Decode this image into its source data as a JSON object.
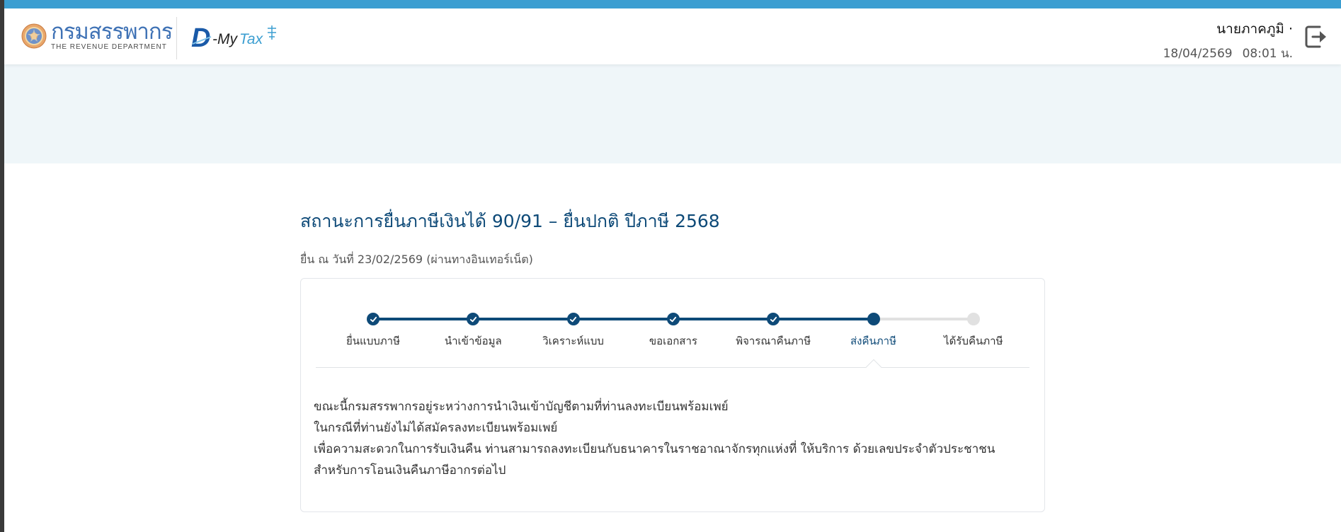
{
  "header": {
    "rd_name": "กรมสรรพากร",
    "rd_sub": "THE REVENUE DEPARTMENT",
    "dmytax_d": "D",
    "dmytax_my": "-My",
    "dmytax_tax": "Tax",
    "user_name": "นายภาคภูมิ ·",
    "date": "18/04/2569",
    "time": "08:01 น.",
    "logout_icon": "logout-icon"
  },
  "page": {
    "title": "สถานะการยื่นภาษีเงินได้ 90/91 – ยื่นปกติ ปีภาษี 2568",
    "subtitle": "ยื่น ณ วันที่ 23/02/2569 (ผ่านทางอินเทอร์เน็ต)"
  },
  "steps": [
    {
      "label": "ยื่นแบบภาษี",
      "status": "done"
    },
    {
      "label": "นำเข้าข้อมูล",
      "status": "done"
    },
    {
      "label": "วิเคราะห์แบบ",
      "status": "done"
    },
    {
      "label": "ขอเอกสาร",
      "status": "done"
    },
    {
      "label": "พิจารณาคืนภาษี",
      "status": "done"
    },
    {
      "label": "ส่งคืนภาษี",
      "status": "current"
    },
    {
      "label": "ได้รับคืนภาษี",
      "status": "pending"
    }
  ],
  "message": {
    "line1": "ขณะนี้กรมสรรพากรอยู่ระหว่างการนำเงินเข้าบัญชีตามที่ท่านลงทะเบียนพร้อมเพย์",
    "line2": "ในกรณีที่ท่านยังไม่ได้สมัครลงทะเบียนพร้อมเพย์",
    "line3": "เพื่อความสะดวกในการรับเงินคืน ท่านสามารถลงทะเบียนกับธนาคารในราชอาณาจักรทุกแห่งที่ ให้บริการ ด้วยเลขประจำตัวประชาชน",
    "line4": "สำหรับการโอนเงินคืนภาษีอากรต่อไป"
  },
  "colors": {
    "primary": "#0e4a78",
    "top_bar": "#3b9ed1",
    "banner": "#eff6f9",
    "pending": "#e1e1e1"
  }
}
